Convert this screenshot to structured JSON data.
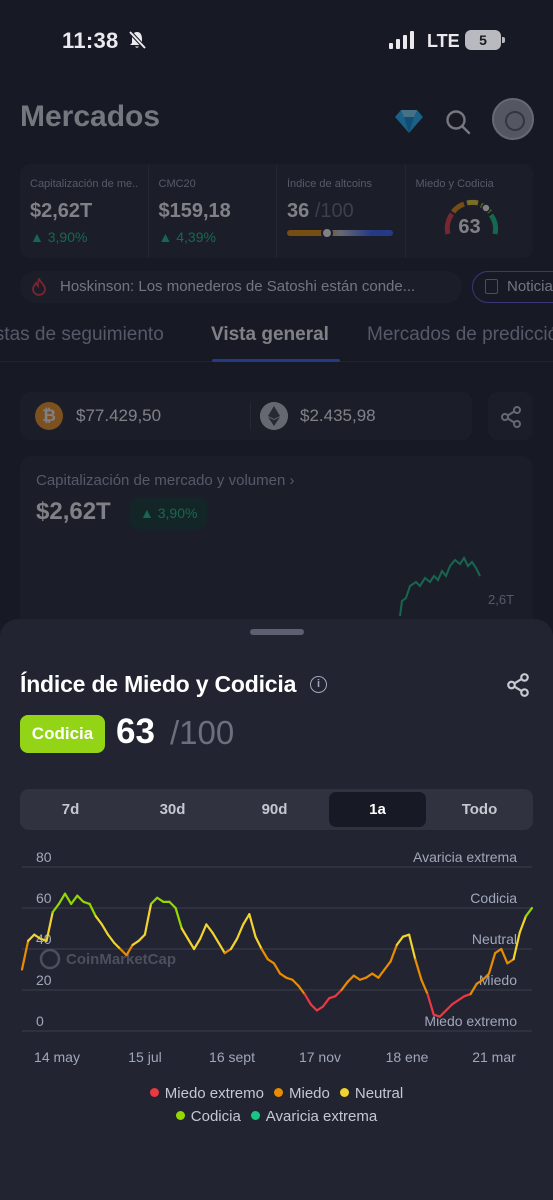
{
  "status": {
    "time": "11:38",
    "network": "LTE",
    "battery": "5"
  },
  "header": {
    "title": "Mercados"
  },
  "stats": [
    {
      "label": "Capitalización de me...",
      "value": "$2,62T",
      "change": "3,90%"
    },
    {
      "label": "CMC20",
      "value": "$159,18",
      "change": "4,39%"
    },
    {
      "label": "Índice de altcoins",
      "value": "36",
      "max": "/100",
      "level": 0.36
    },
    {
      "label": "Miedo y Codicia",
      "value": "63",
      "level": 0.63
    }
  ],
  "news": {
    "headline": "Hoskinson: Los monederos de Satoshi están conde...",
    "button": "Noticias"
  },
  "tabs": [
    {
      "label": "Listas de seguimiento"
    },
    {
      "label": "Vista general"
    },
    {
      "label": "Mercados de predicción"
    }
  ],
  "prices": {
    "btc": "$77.429,50",
    "eth": "$2.435,98"
  },
  "market_card": {
    "title": "Capitalización de mercado y volumen",
    "value": "$2,62T",
    "change": "3,90%",
    "axis_label": "2,6T"
  },
  "sheet": {
    "title": "Índice de Miedo y Codicia",
    "badge": "Codicia",
    "score": "63",
    "max": "/100",
    "ranges": [
      {
        "label": "7d"
      },
      {
        "label": "30d"
      },
      {
        "label": "90d"
      },
      {
        "label": "1a"
      },
      {
        "label": "Todo"
      }
    ],
    "watermark": "CoinMarketCap"
  },
  "colors": {
    "miedo_extremo": "#ea3943",
    "miedo": "#ea8c00",
    "neutral": "#f3d42f",
    "codicia": "#93d900",
    "avaricia_extrema": "#16c784",
    "badge": "#93d417",
    "accent": "#3861fb"
  },
  "chart_data": {
    "type": "line",
    "title": "",
    "y_ticks": [
      "80",
      "60",
      "40",
      "20",
      "0"
    ],
    "y_zone_labels": [
      "Avaricia extrema",
      "Codicia",
      "Neutral",
      "Miedo",
      "Miedo extremo"
    ],
    "x_ticks": [
      "14 may",
      "15 jul",
      "16 sept",
      "17 nov",
      "18 ene",
      "21 mar"
    ],
    "ylim": [
      0,
      80
    ],
    "grid": true,
    "legend": [
      "Miedo extremo",
      "Miedo",
      "Neutral",
      "Codicia",
      "Avaricia extrema"
    ],
    "legend_placement": "bottom",
    "series": [
      {
        "values": [
          30,
          44,
          47,
          45,
          44,
          58,
          62,
          67,
          62,
          66,
          63,
          62,
          56,
          52,
          47,
          43,
          40,
          37,
          42,
          44,
          47,
          62,
          65,
          63,
          63,
          60,
          50,
          45,
          40,
          45,
          52,
          48,
          43,
          38,
          40,
          45,
          52,
          57,
          46,
          40,
          35,
          33,
          28,
          26,
          25,
          22,
          18,
          13,
          10,
          12,
          16,
          17,
          20,
          24,
          27,
          25,
          26,
          28,
          26,
          30,
          34,
          42,
          46,
          47,
          35,
          25,
          18,
          8,
          7,
          10,
          13,
          15,
          17,
          18,
          23,
          25,
          28,
          38,
          40,
          33,
          35,
          48,
          56,
          60
        ]
      }
    ]
  }
}
